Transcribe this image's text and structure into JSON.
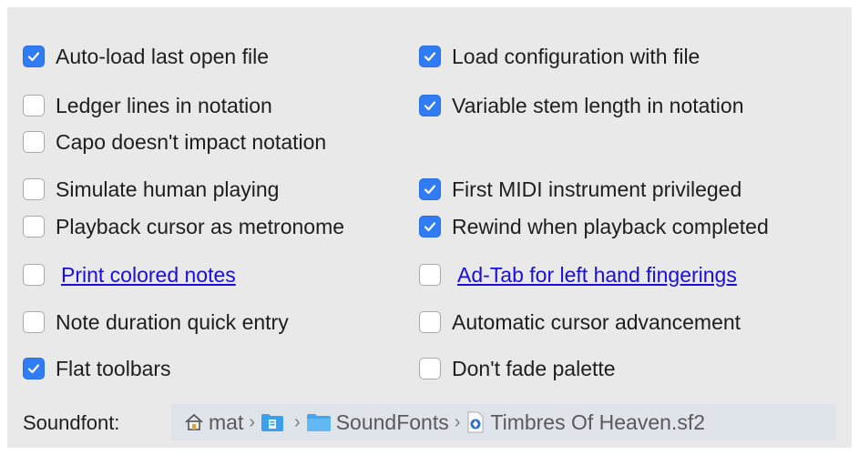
{
  "options": {
    "left": [
      {
        "label": "Auto-load last open file",
        "checked": true,
        "link": false
      },
      {
        "label": "Ledger lines in notation",
        "checked": false,
        "link": false
      },
      {
        "label": "Capo doesn't impact notation",
        "checked": false,
        "link": false
      },
      {
        "label": "Simulate human playing",
        "checked": false,
        "link": false
      },
      {
        "label": "Playback cursor as metronome",
        "checked": false,
        "link": false
      },
      {
        "label": "Print colored notes",
        "checked": false,
        "link": true
      },
      {
        "label": "Note duration quick entry",
        "checked": false,
        "link": false
      },
      {
        "label": "Flat toolbars",
        "checked": true,
        "link": false
      }
    ],
    "right": [
      {
        "label": "Load configuration with file",
        "checked": true,
        "link": false
      },
      {
        "label": "Variable stem length in notation",
        "checked": true,
        "link": false
      },
      {
        "label": "First MIDI instrument privileged",
        "checked": true,
        "link": false
      },
      {
        "label": "Rewind when playback completed",
        "checked": true,
        "link": false
      },
      {
        "label": "Ad-Tab for left hand fingerings",
        "checked": false,
        "link": true
      },
      {
        "label": "Automatic cursor advancement",
        "checked": false,
        "link": false
      },
      {
        "label": "Don't fade palette",
        "checked": false,
        "link": false
      }
    ]
  },
  "soundfont": {
    "label": "Soundfont:",
    "path": [
      {
        "name": "mat",
        "icon": "home-icon"
      },
      {
        "name": "",
        "icon": "documents-folder-icon"
      },
      {
        "name": "SoundFonts",
        "icon": "folder-icon"
      },
      {
        "name": "Timbres Of Heaven.sf2",
        "icon": "soundfont-file-icon"
      }
    ]
  },
  "colors": {
    "checkbox_on": "#2f7cf6",
    "link": "#1a0dde",
    "panel_bg": "#e9e9e9"
  }
}
